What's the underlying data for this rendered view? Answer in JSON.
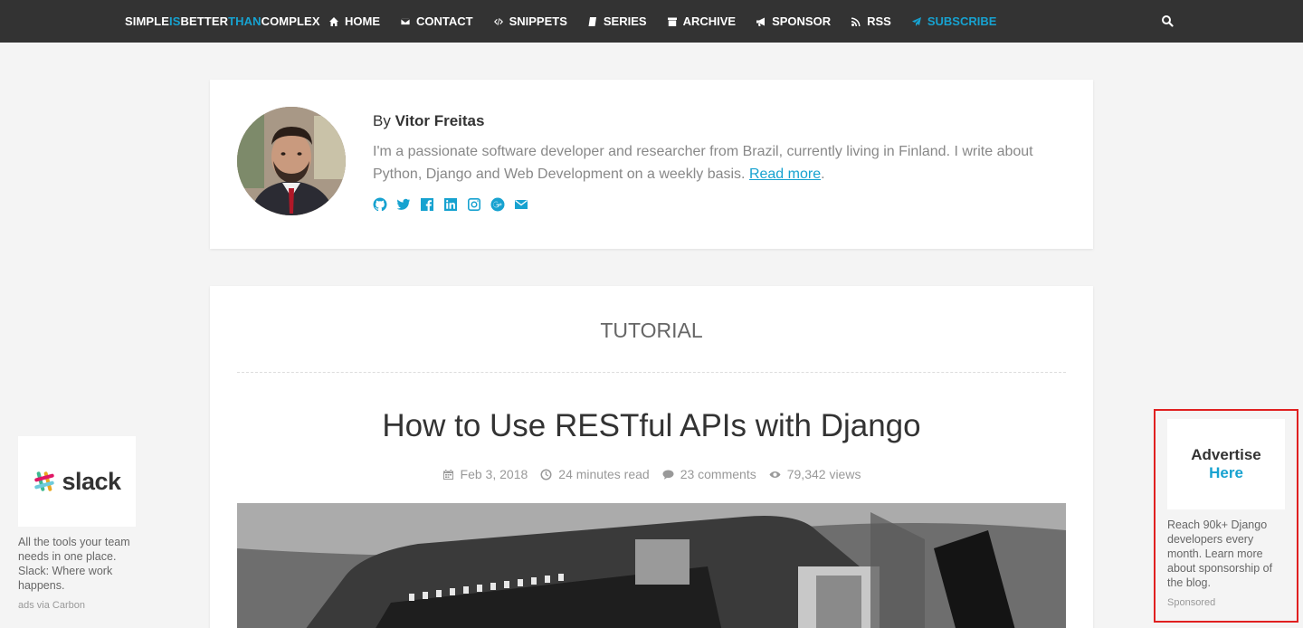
{
  "brand": {
    "part1": "SIMPLE",
    "part2": "IS",
    "part3": "BETTER",
    "part4": "THAN",
    "part5": "COMPLEX"
  },
  "nav": [
    {
      "label": "HOME",
      "icon": "home-icon"
    },
    {
      "label": "CONTACT",
      "icon": "envelope-icon"
    },
    {
      "label": "SNIPPETS",
      "icon": "code-icon"
    },
    {
      "label": "SERIES",
      "icon": "book-icon"
    },
    {
      "label": "ARCHIVE",
      "icon": "archive-icon"
    },
    {
      "label": "SPONSOR",
      "icon": "bullhorn-icon"
    },
    {
      "label": "RSS",
      "icon": "rss-icon"
    },
    {
      "label": "SUBSCRIBE",
      "icon": "paper-plane-icon"
    }
  ],
  "author": {
    "by": "By",
    "name": "Vitor Freitas",
    "bio": "I'm a passionate software developer and researcher from Brazil, currently living in Finland. I write about Python, Django and Web Development on a weekly basis.",
    "read_more": "Read more",
    "after_link": ".",
    "socials": [
      "github-icon",
      "twitter-icon",
      "facebook-icon",
      "linkedin-icon",
      "instagram-icon",
      "google-plus-icon",
      "envelope-icon"
    ]
  },
  "post": {
    "category": "TUTORIAL",
    "title": "How to Use RESTful APIs with Django",
    "date": "Feb 3, 2018",
    "read_time": "24 minutes read",
    "comments": "23 comments",
    "views": "79,342 views"
  },
  "ad_left": {
    "logo": "slack",
    "text": "All the tools your team needs in one place. Slack: Where work happens.",
    "via": "ads via Carbon"
  },
  "ad_right": {
    "line1": "Advertise",
    "line2": "Here",
    "text": "Reach 90k+ Django developers every month. Learn more about sponsorship of the blog.",
    "label": "Sponsored"
  },
  "colors": {
    "accent": "#17a2d0",
    "nav_bg": "#333333",
    "highlight_border": "#e02020"
  }
}
